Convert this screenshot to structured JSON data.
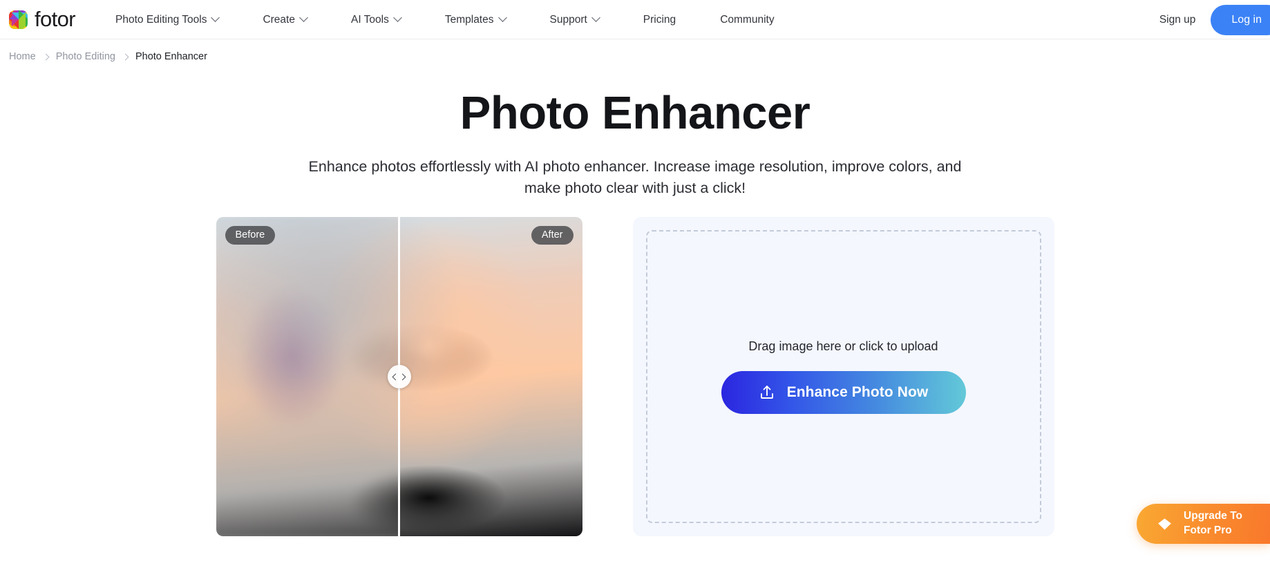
{
  "navbar": {
    "logo_text": "fotor",
    "logo_icon": "fotor-color-wheel-icon",
    "items": [
      {
        "label": "Photo Editing Tools",
        "has_dropdown": true
      },
      {
        "label": "Create",
        "has_dropdown": true
      },
      {
        "label": "AI Tools",
        "has_dropdown": true
      },
      {
        "label": "Templates",
        "has_dropdown": true
      },
      {
        "label": "Support",
        "has_dropdown": true
      },
      {
        "label": "Pricing",
        "has_dropdown": false
      },
      {
        "label": "Community",
        "has_dropdown": false
      }
    ],
    "signup_label": "Sign up",
    "login_label": "Log in",
    "login_color": "#3b82f6"
  },
  "breadcrumb": {
    "items": [
      {
        "label": "Home"
      },
      {
        "label": "Photo Editing"
      },
      {
        "label": "Photo Enhancer"
      }
    ]
  },
  "hero": {
    "title": "Photo Enhancer",
    "subtitle": "Enhance photos effortlessly with AI photo enhancer. Increase image resolution, improve colors, and make photo clear with just a click!"
  },
  "compare": {
    "before_label": "Before",
    "after_label": "After",
    "handle_icon": "left-right-arrows-icon",
    "split_position_percent": 50
  },
  "upload": {
    "drop_text": "Drag image here or click to upload",
    "button_label": "Enhance Photo Now",
    "button_icon": "upload-icon",
    "gradient_start": "#2b26e0",
    "gradient_end": "#63c9d8"
  },
  "upgrade": {
    "line1": "Upgrade To",
    "line2": "Fotor Pro",
    "icon": "diamond-icon",
    "gradient_start": "#f9a933",
    "gradient_end": "#f9782c"
  }
}
